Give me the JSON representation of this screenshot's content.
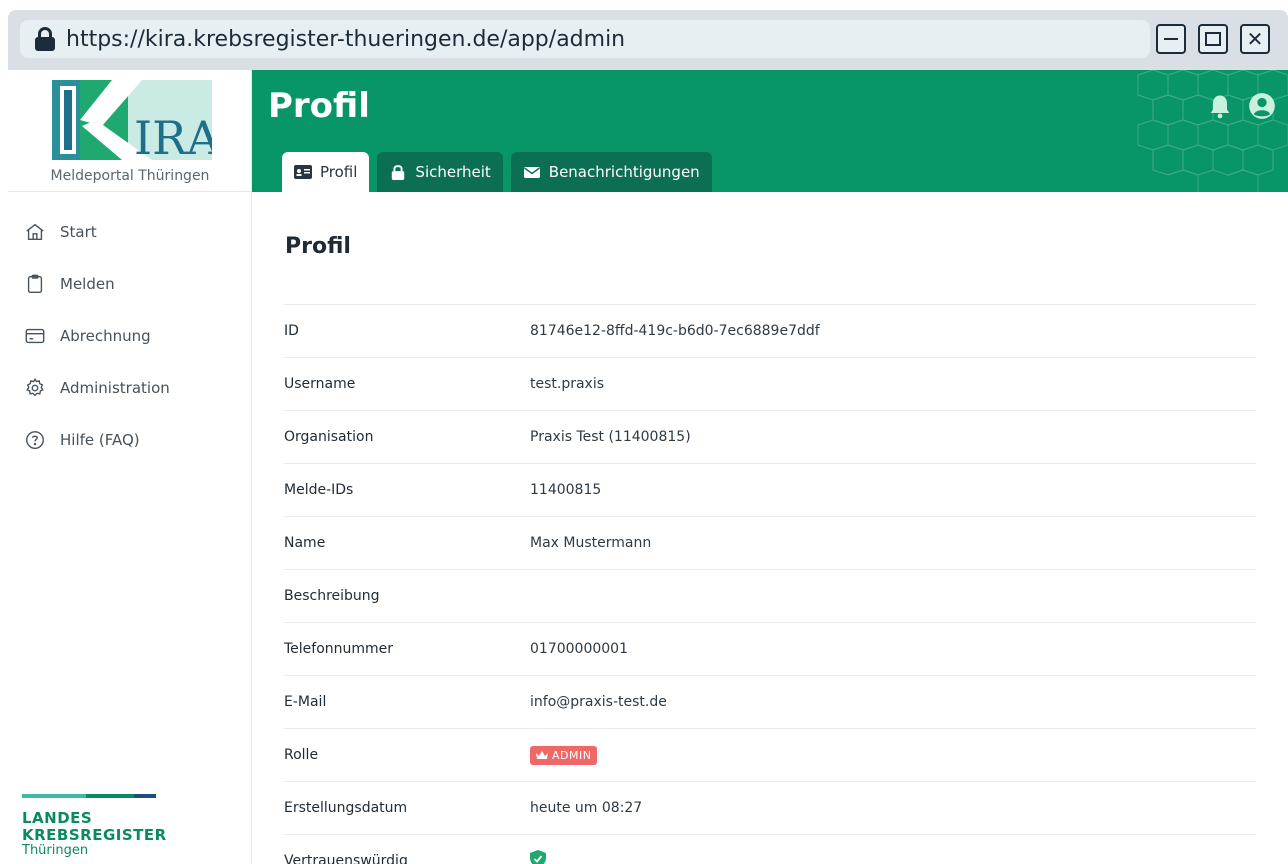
{
  "browser": {
    "url": "https://kira.krebsregister-thueringen.de/app/admin"
  },
  "sidebar": {
    "logo_text": "KIRA",
    "portal_name": "Meldeportal Thüringen",
    "items": [
      {
        "label": "Start",
        "icon": "home-icon"
      },
      {
        "label": "Melden",
        "icon": "clipboard-icon"
      },
      {
        "label": "Abrechnung",
        "icon": "credit-card-icon"
      },
      {
        "label": "Administration",
        "icon": "gear-icon"
      },
      {
        "label": "Hilfe (FAQ)",
        "icon": "help-circle-icon"
      }
    ],
    "footer_logo": {
      "line1": "LANDES",
      "line2": "KREBSREGISTER",
      "line3": "Thüringen"
    }
  },
  "header": {
    "title": "Profil",
    "tabs": [
      {
        "label": "Profil",
        "icon": "id-card-icon",
        "active": true
      },
      {
        "label": "Sicherheit",
        "icon": "lock-icon",
        "active": false
      },
      {
        "label": "Benachrichtigungen",
        "icon": "envelope-icon",
        "active": false
      }
    ]
  },
  "profile": {
    "title": "Profil",
    "rows": [
      {
        "key": "ID",
        "value": "81746e12-8ffd-419c-b6d0-7ec6889e7ddf"
      },
      {
        "key": "Username",
        "value": "test.praxis"
      },
      {
        "key": "Organisation",
        "value": "Praxis Test (11400815)"
      },
      {
        "key": "Melde-IDs",
        "value": "11400815"
      },
      {
        "key": "Name",
        "value": "Max Mustermann"
      },
      {
        "key": "Beschreibung",
        "value": ""
      },
      {
        "key": "Telefonnummer",
        "value": "01700000001"
      },
      {
        "key": "E-Mail",
        "value": "info@praxis-test.de"
      },
      {
        "key": "Rolle",
        "badge": "ADMIN"
      },
      {
        "key": "Erstellungsdatum",
        "value": "heute um 08:27"
      },
      {
        "key": "Vertrauenswürdig",
        "icon": "shield-check-icon"
      }
    ]
  },
  "colors": {
    "primary_green": "#089567",
    "dark_green_tab": "#0c6e52",
    "admin_badge": "#f06767",
    "logo_teal": "#2b8f9a",
    "logo_green": "#1fa870"
  }
}
